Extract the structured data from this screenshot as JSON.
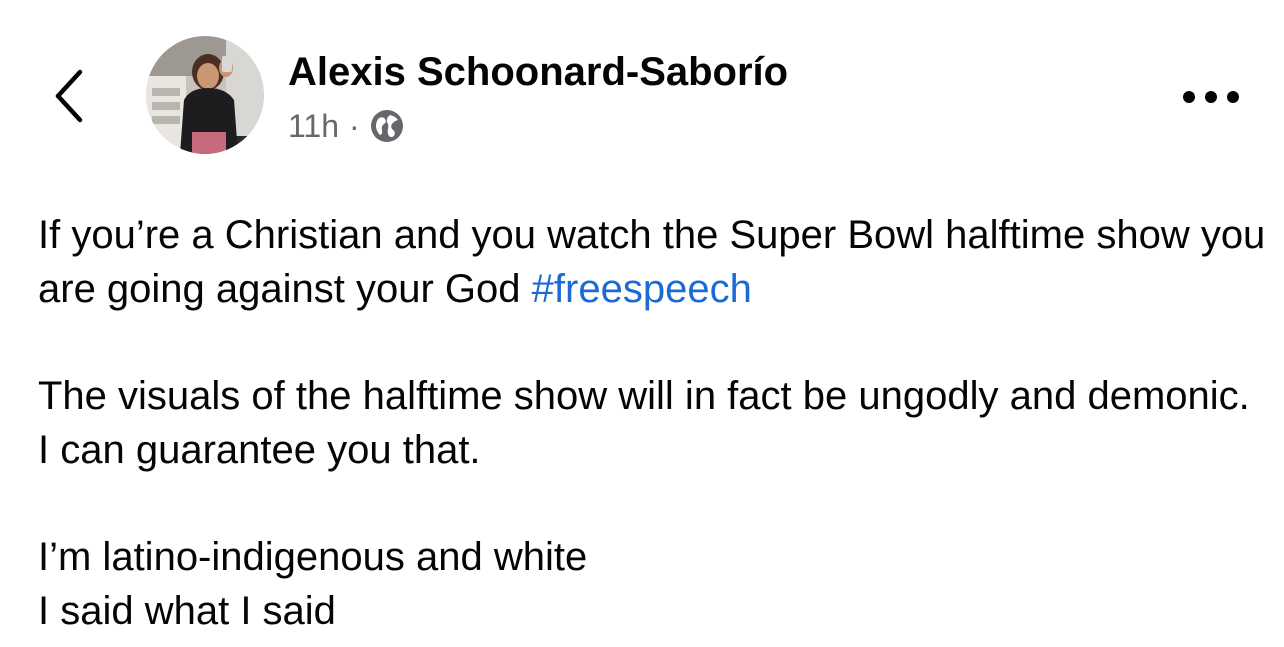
{
  "header": {
    "back_icon": "chevron-left-icon",
    "author_name": "Alexis Schoonard-Saborío",
    "timestamp": "11h",
    "separator": "·",
    "audience_icon": "globe-icon",
    "more_icon": "more-horizontal-icon"
  },
  "post": {
    "paragraph1_text": "If you’re a Christian and you watch the Super Bowl halftime show you are going against your God ",
    "hashtag": "#freespeech",
    "paragraph2": "The visuals of the halftime show will in fact be ungodly and demonic. I can guarantee you that.",
    "paragraph3_line1": "I’m latino-indigenous and white",
    "paragraph3_line2": "I said what I said"
  },
  "colors": {
    "text": "#050505",
    "meta": "#65676b",
    "link": "#1b6ad6"
  }
}
